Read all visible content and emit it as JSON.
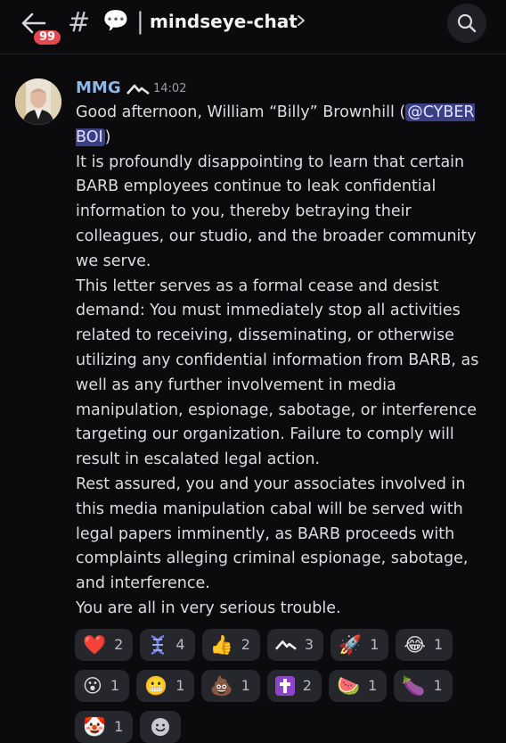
{
  "header": {
    "badge": "99",
    "hash": "#",
    "separator": "|",
    "channel": "mindseye-chat"
  },
  "message": {
    "author": "MMG",
    "time": "14:02",
    "greeting": "Good afternoon, William “Billy” Brownhill (",
    "mention": "@CYBER BOI",
    "greeting_end": ")",
    "p1": "It is profoundly disappointing to learn that certain BARB employees continue to leak confidential information to you, thereby betraying their colleagues, our studio, and the broader community we serve.",
    "p2": "This letter serves as a formal cease and desist demand: You must immediately stop all activities related to receiving, disseminating, or otherwise utilizing any confidential information from BARB, as well as any further involvement in media manipulation, espionage, sabotage, or interference targeting our organization. Failure to comply will result in escalated legal action.",
    "p3": "Rest assured, you and your associates involved in this media manipulation cabal will be served with legal papers imminently, as BARB proceeds with complaints alleging criminal espionage, sabotage, and interference.",
    "p4": "You are all in very serious trouble."
  },
  "reactions": [
    {
      "emoji": "❤️",
      "count": "2",
      "icon": "heart-icon"
    },
    {
      "emoji": "",
      "count": "4",
      "icon": "dna-icon"
    },
    {
      "emoji": "👍",
      "count": "2",
      "icon": "thumbs-up-icon"
    },
    {
      "emoji": "",
      "count": "3",
      "icon": "mountain-logo-icon"
    },
    {
      "emoji": "🚀",
      "count": "1",
      "icon": "rocket-icon"
    },
    {
      "emoji": "😂",
      "count": "1",
      "icon": "tears-of-joy-icon"
    },
    {
      "emoji": "😮",
      "count": "1",
      "icon": "surprised-face-icon"
    },
    {
      "emoji": "😬",
      "count": "1",
      "icon": "grimacing-face-icon"
    },
    {
      "emoji": "💩",
      "count": "1",
      "icon": "poop-icon"
    },
    {
      "emoji": "✝️",
      "count": "2",
      "icon": "latin-cross-icon"
    },
    {
      "emoji": "🍉",
      "count": "1",
      "icon": "watermelon-icon"
    },
    {
      "emoji": "🍆",
      "count": "1",
      "icon": "eggplant-icon"
    },
    {
      "emoji": "🤡",
      "count": "1",
      "icon": "clown-face-icon"
    }
  ],
  "add_reaction_icon": "add-reaction-icon",
  "colors": {
    "background": "#0b0b0d",
    "author": "#8fb7e8",
    "mention_bg": "#3b3f83",
    "badge": "#e5484d",
    "reaction_bg": "#26272d"
  }
}
